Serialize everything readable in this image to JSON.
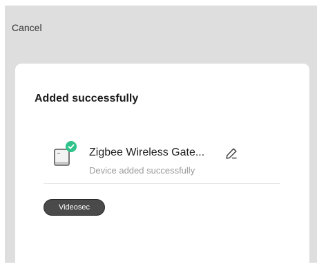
{
  "header": {
    "cancel_label": "Cancel"
  },
  "card": {
    "title": "Added successfully",
    "device": {
      "name": "Zigbee Wireless Gate...",
      "status": "Device added successfully",
      "icon": "gateway-device-icon",
      "badge_icon": "check-icon",
      "edit_icon": "pencil-icon"
    },
    "room_chip_label": "Videosec"
  },
  "colors": {
    "background": "#dedede",
    "card": "#ffffff",
    "success": "#2fc28b",
    "chip": "#4a4a4a"
  }
}
